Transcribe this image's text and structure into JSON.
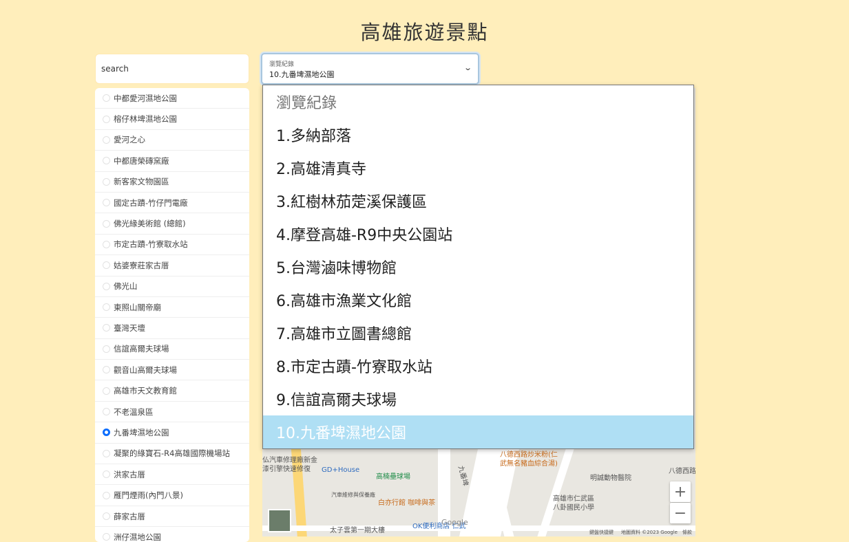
{
  "page": {
    "title": "高雄旅遊景點"
  },
  "search": {
    "placeholder": "search"
  },
  "places": [
    {
      "label": "中都愛河濕地公園",
      "checked": false
    },
    {
      "label": "榕仔林埤濕地公園",
      "checked": false
    },
    {
      "label": "愛河之心",
      "checked": false
    },
    {
      "label": "中都唐榮磚窯廠",
      "checked": false
    },
    {
      "label": "新客家文物園區",
      "checked": false
    },
    {
      "label": "國定古蹟-竹仔門電廠",
      "checked": false
    },
    {
      "label": "佛光緣美術館 (總館)",
      "checked": false
    },
    {
      "label": "市定古蹟-竹寮取水站",
      "checked": false
    },
    {
      "label": "姑婆寮莊家古厝",
      "checked": false
    },
    {
      "label": "佛光山",
      "checked": false
    },
    {
      "label": "東照山關帝廟",
      "checked": false
    },
    {
      "label": "臺灣天壇",
      "checked": false
    },
    {
      "label": "信誼高爾夫球場",
      "checked": false
    },
    {
      "label": "觀音山高爾夫球場",
      "checked": false
    },
    {
      "label": "高雄市天文教育館",
      "checked": false
    },
    {
      "label": "不老溫泉區",
      "checked": false
    },
    {
      "label": "九番埤濕地公園",
      "checked": true
    },
    {
      "label": "凝聚的綠寶石-R4高雄國際機場站",
      "checked": false
    },
    {
      "label": "洪家古厝",
      "checked": false
    },
    {
      "label": "雁門煙雨(內門八景)",
      "checked": false
    },
    {
      "label": "薛家古厝",
      "checked": false
    },
    {
      "label": "洲仔濕地公園",
      "checked": false
    }
  ],
  "history_select": {
    "label": "瀏覽紀錄",
    "value": "10.九番埤濕地公園",
    "options": [
      {
        "label": "瀏覽紀錄"
      },
      {
        "label": "1.多納部落"
      },
      {
        "label": "2.高雄清真寺"
      },
      {
        "label": "3.紅樹林茄萣溪保護區"
      },
      {
        "label": "4.摩登高雄-R9中央公園站"
      },
      {
        "label": "5.台灣滷味博物館"
      },
      {
        "label": "6.高雄市漁業文化館"
      },
      {
        "label": "7.高雄市立圖書總館"
      },
      {
        "label": "8.市定古蹟-竹寮取水站"
      },
      {
        "label": "9.信誼高爾夫球場"
      },
      {
        "label": "10.九番埤濕地公園"
      }
    ]
  },
  "map": {
    "labels": {
      "garage": "仏汽車修理廠新金",
      "garage2": "漆引擎快速修復",
      "gdhouse": "GD+House",
      "baseball": "高楠壘球場",
      "repair": "汽車維修與保養廠",
      "cafe": "白亦行館 咖啡與茶",
      "building": "太子雲第一期大樓",
      "ok_store": "OK便利商店 仁武",
      "restaurant": "八德西路炒米粉(仁",
      "restaurant2": "武無名豬血綜合湯)",
      "hospital": "明誠動物醫院",
      "school": "高雄市仁武區",
      "school2": "八卦國民小學",
      "road": "九番埤",
      "bade": "八德西路",
      "google": "Google",
      "shortcuts": "鍵盤快捷鍵",
      "mapdata": "地圖資料 ©2023 Google",
      "terms": "條款"
    },
    "zoom_in": "+",
    "zoom_out": "−"
  }
}
